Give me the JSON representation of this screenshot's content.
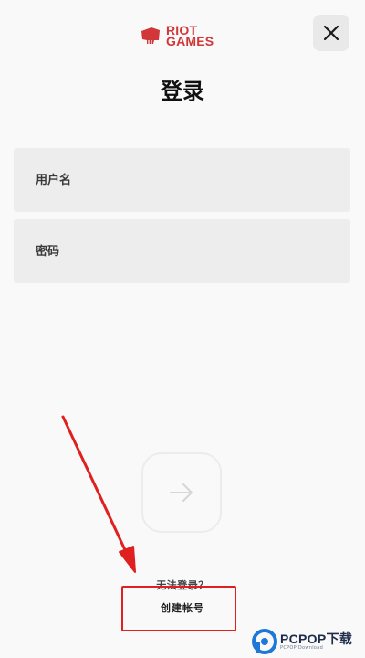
{
  "brand": {
    "line1": "RIOT",
    "line2": "GAMES",
    "color": "#d13639"
  },
  "header": {
    "close_icon": "close-icon"
  },
  "page": {
    "title": "登录"
  },
  "form": {
    "username_placeholder": "用户名",
    "password_placeholder": "密码",
    "submit_icon": "arrow-right-icon"
  },
  "links": {
    "cant_login": "无法登录？",
    "create_account": "创建帐号"
  },
  "annotation": {
    "color": "#e02020"
  },
  "watermark": {
    "text": "PCPOP下载",
    "subtext": "PCPOP Download"
  }
}
